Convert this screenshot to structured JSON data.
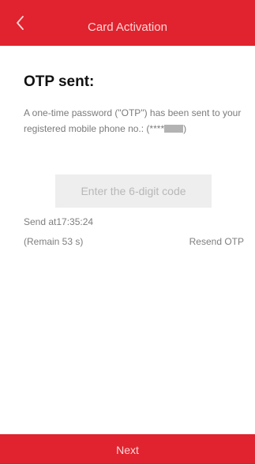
{
  "header": {
    "title": "Card Activation",
    "back_icon": "chevron-left-icon"
  },
  "content": {
    "title": "OTP sent:",
    "description_prefix": "A one-time password (\"OTP\") has been sent to your registered mobile phone no.: (****",
    "description_suffix": ")"
  },
  "otp": {
    "placeholder": "Enter the 6-digit code",
    "value": ""
  },
  "status": {
    "send_time": "Send at17:35:24",
    "remain": "(Remain 53 s)",
    "resend": "Resend OTP"
  },
  "footer": {
    "next_label": "Next"
  },
  "colors": {
    "accent": "#e0232e",
    "accent_text": "#ffd7d9"
  }
}
